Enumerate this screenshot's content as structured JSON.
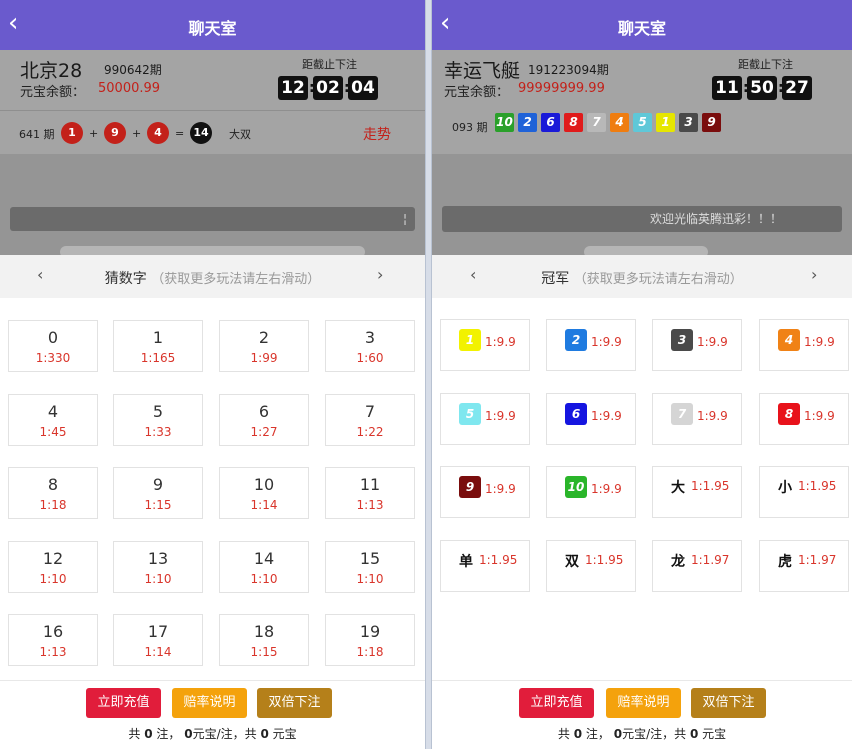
{
  "colors": {
    "header": "#6a5acd",
    "red": "#c3211a",
    "odds": "#d9352b",
    "btn_recharge": "#e11d3b",
    "btn_rate": "#f4a20c",
    "btn_double": "#b5801a"
  },
  "left": {
    "back_icon": "chevron-left-icon",
    "title": "聊天室",
    "game_name": "北京28",
    "period": "990642期",
    "balance_label": "元宝余额：",
    "balance": "50000.99",
    "countdown_label": "距截止下注",
    "countdown": [
      "12",
      "02",
      "04"
    ],
    "result_period": "641 期",
    "result_balls": [
      "1",
      "9",
      "4"
    ],
    "result_sum": "14",
    "result_text": "大双",
    "trend": "走势",
    "chat_bar_text": "",
    "tab_title": "猜数字",
    "tab_hint": "（获取更多玩法请左右滑动）",
    "cells": [
      {
        "num": "0",
        "odds": "1:330"
      },
      {
        "num": "1",
        "odds": "1:165"
      },
      {
        "num": "2",
        "odds": "1:99"
      },
      {
        "num": "3",
        "odds": "1:60"
      },
      {
        "num": "4",
        "odds": "1:45"
      },
      {
        "num": "5",
        "odds": "1:33"
      },
      {
        "num": "6",
        "odds": "1:27"
      },
      {
        "num": "7",
        "odds": "1:22"
      },
      {
        "num": "8",
        "odds": "1:18"
      },
      {
        "num": "9",
        "odds": "1:15"
      },
      {
        "num": "10",
        "odds": "1:14"
      },
      {
        "num": "11",
        "odds": "1:13"
      },
      {
        "num": "12",
        "odds": "1:10"
      },
      {
        "num": "13",
        "odds": "1:10"
      },
      {
        "num": "14",
        "odds": "1:10"
      },
      {
        "num": "15",
        "odds": "1:10"
      },
      {
        "num": "16",
        "odds": "1:13"
      },
      {
        "num": "17",
        "odds": "1:14"
      },
      {
        "num": "18",
        "odds": "1:15"
      },
      {
        "num": "19",
        "odds": "1:18"
      }
    ],
    "buttons": {
      "recharge": "立即充值",
      "rate": "赔率说明",
      "double": "双倍下注"
    },
    "summary": {
      "p1": "共",
      "count": "0",
      "p2": "注，",
      "per": "0",
      "p3": "元宝/注，共",
      "total": "0",
      "p4": "元宝"
    }
  },
  "right": {
    "back_icon": "chevron-left-icon",
    "title": "聊天室",
    "game_name": "幸运飞艇",
    "period": "191223094期",
    "balance_label": "元宝余额：",
    "balance": "99999999.99",
    "countdown_label": "距截止下注",
    "countdown": [
      "11",
      "50",
      "27"
    ],
    "result_period": "093 期",
    "result_numbers": [
      {
        "n": "10",
        "color": "#2aa02a"
      },
      {
        "n": "2",
        "color": "#1f62d8"
      },
      {
        "n": "6",
        "color": "#1a1ad8"
      },
      {
        "n": "8",
        "color": "#e01b1b"
      },
      {
        "n": "7",
        "color": "#b8b8b8"
      },
      {
        "n": "4",
        "color": "#ef7d10"
      },
      {
        "n": "5",
        "color": "#5fc8d8"
      },
      {
        "n": "1",
        "color": "#e6e600"
      },
      {
        "n": "3",
        "color": "#4a4a4a"
      },
      {
        "n": "9",
        "color": "#7a0d0d"
      }
    ],
    "chat_bar_text": "欢迎光临英腾迅彩！！！",
    "tab_title": "冠军",
    "tab_hint": "（获取更多玩法请左右滑动）",
    "cells": [
      {
        "n": "1",
        "color": "#f2f200",
        "odds": "1:9.9",
        "text": ""
      },
      {
        "n": "2",
        "color": "#1f7be0",
        "odds": "1:9.9",
        "text": ""
      },
      {
        "n": "3",
        "color": "#4a4a4a",
        "odds": "1:9.9",
        "text": ""
      },
      {
        "n": "4",
        "color": "#f08216",
        "odds": "1:9.9",
        "text": ""
      },
      {
        "n": "5",
        "color": "#7fe7ef",
        "odds": "1:9.9",
        "text": ""
      },
      {
        "n": "6",
        "color": "#1515e0",
        "odds": "1:9.9",
        "text": ""
      },
      {
        "n": "7",
        "color": "#d5d5d5",
        "odds": "1:9.9",
        "text": ""
      },
      {
        "n": "8",
        "color": "#e8121b",
        "odds": "1:9.9",
        "text": ""
      },
      {
        "n": "9",
        "color": "#7a0d0d",
        "odds": "1:9.9",
        "text": ""
      },
      {
        "n": "10",
        "color": "#2ab52a",
        "odds": "1:9.9",
        "text": ""
      },
      {
        "n": "",
        "color": "",
        "odds": "1:1.95",
        "text": "大"
      },
      {
        "n": "",
        "color": "",
        "odds": "1:1.95",
        "text": "小"
      },
      {
        "n": "",
        "color": "",
        "odds": "1:1.95",
        "text": "单"
      },
      {
        "n": "",
        "color": "",
        "odds": "1:1.95",
        "text": "双"
      },
      {
        "n": "",
        "color": "",
        "odds": "1:1.97",
        "text": "龙"
      },
      {
        "n": "",
        "color": "",
        "odds": "1:1.97",
        "text": "虎"
      }
    ],
    "buttons": {
      "recharge": "立即充值",
      "rate": "赔率说明",
      "double": "双倍下注"
    },
    "summary": {
      "p1": "共",
      "count": "0",
      "p2": "注，",
      "per": "0",
      "p3": "元宝/注，共",
      "total": "0",
      "p4": "元宝"
    }
  }
}
